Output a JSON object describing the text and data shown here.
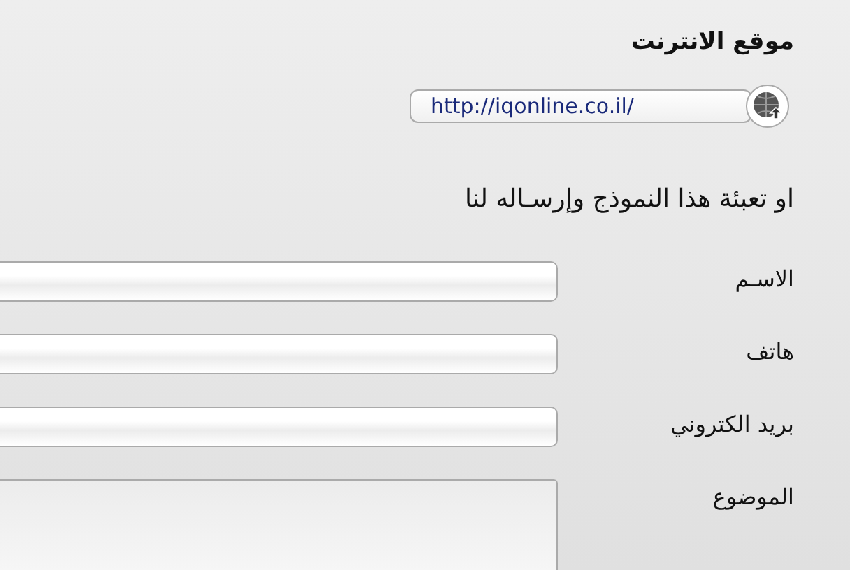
{
  "website": {
    "heading": "موقع الانترنت",
    "url": "http://iqonline.co.il/"
  },
  "intro": "او تعبئة هذا النموذج وإرسـاله لنا",
  "form": {
    "fields": [
      {
        "label": "الاسـم",
        "kind": "line"
      },
      {
        "label": "هاتف",
        "kind": "line"
      },
      {
        "label": "بريد الكتروني",
        "kind": "line"
      },
      {
        "label": "الموضوع",
        "kind": "area"
      }
    ]
  }
}
